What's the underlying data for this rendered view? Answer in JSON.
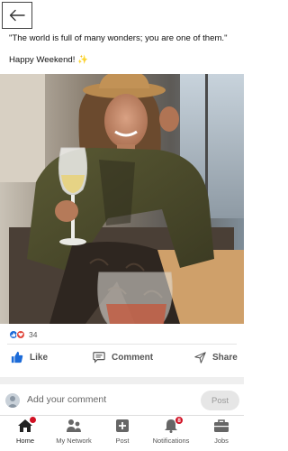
{
  "header": {
    "back_icon": "arrow-left-icon"
  },
  "post": {
    "line1": "\"The world is full of many wonders; you are one of them.\"",
    "line2": "Happy Weekend! ✨"
  },
  "reactions": {
    "count": "34",
    "icons": [
      "like-reaction-icon",
      "heart-reaction-icon"
    ]
  },
  "actions": {
    "like": "Like",
    "comment": "Comment",
    "share": "Share"
  },
  "comment": {
    "placeholder": "Add your comment",
    "post_label": "Post"
  },
  "nav": {
    "home": "Home",
    "network": "My Network",
    "post": "Post",
    "notifications": "Notifications",
    "notifications_badge": "8",
    "jobs": "Jobs"
  },
  "colors": {
    "accent": "#0a66c2",
    "like_blue": "#1c6bd8",
    "heart_red": "#e0453a",
    "badge_red": "#d11124"
  }
}
